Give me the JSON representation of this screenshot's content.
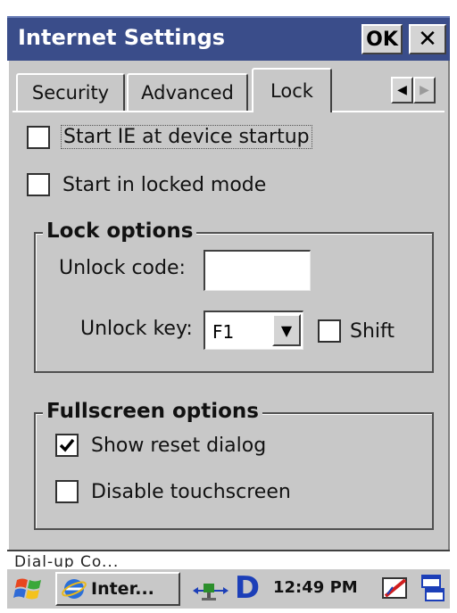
{
  "window": {
    "title": "Internet Settings",
    "ok_label": "OK",
    "close_label": "✕"
  },
  "tabs": [
    {
      "label": "Security",
      "selected": false
    },
    {
      "label": "Advanced",
      "selected": false
    },
    {
      "label": "Lock",
      "selected": true
    }
  ],
  "tab_scroll": {
    "left": "◀",
    "right": "▶"
  },
  "options": {
    "start_ie": {
      "label": "Start IE at device startup",
      "checked": false
    },
    "start_locked": {
      "label": "Start in locked mode",
      "checked": false
    }
  },
  "lock_options": {
    "title": "Lock options",
    "unlock_code_label": "Unlock code:",
    "unlock_code_value": "",
    "unlock_key_label": "Unlock key:",
    "unlock_key_value": "F1",
    "shift": {
      "label": "Shift",
      "checked": false
    }
  },
  "fullscreen_options": {
    "title": "Fullscreen options",
    "show_reset": {
      "label": "Show reset dialog",
      "checked": true
    },
    "disable_touch": {
      "label": "Disable touchscreen",
      "checked": false
    }
  },
  "background_window": {
    "text": "Dial-up Co..."
  },
  "taskbar": {
    "task_label": "Inter...",
    "clock": "12:49 PM",
    "tray_d": "D",
    "icons": [
      "windows-start-icon",
      "internet-explorer-icon",
      "network-icon",
      "d-app-icon",
      "stylus-icon",
      "task-switch-icon"
    ]
  },
  "colors": {
    "titlebar": "#3a4d8a",
    "panel": "#c8c8c8",
    "tray_d": "#1c3fb8"
  }
}
